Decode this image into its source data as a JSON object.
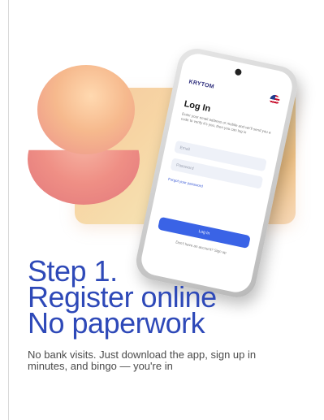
{
  "phone": {
    "brand": "KRYTOM",
    "login_title": "Log In",
    "login_description": "Enter your email address or mobile and we'll send you a code to verify it's you, then you can log in",
    "email_placeholder": "Email",
    "password_placeholder": "Password",
    "forgot_password": "Forgot your password",
    "login_button": "Log In",
    "signup_prompt": "Don't have an account? Sign up"
  },
  "step": {
    "line1": "Step 1.",
    "line2": "Register online",
    "line3": "No paperwork",
    "description": "No bank visits. Just download the app, sign up in minutes, and bingo — you're in"
  },
  "colors": {
    "accent": "#2e49b8",
    "button": "#3a63e6"
  }
}
